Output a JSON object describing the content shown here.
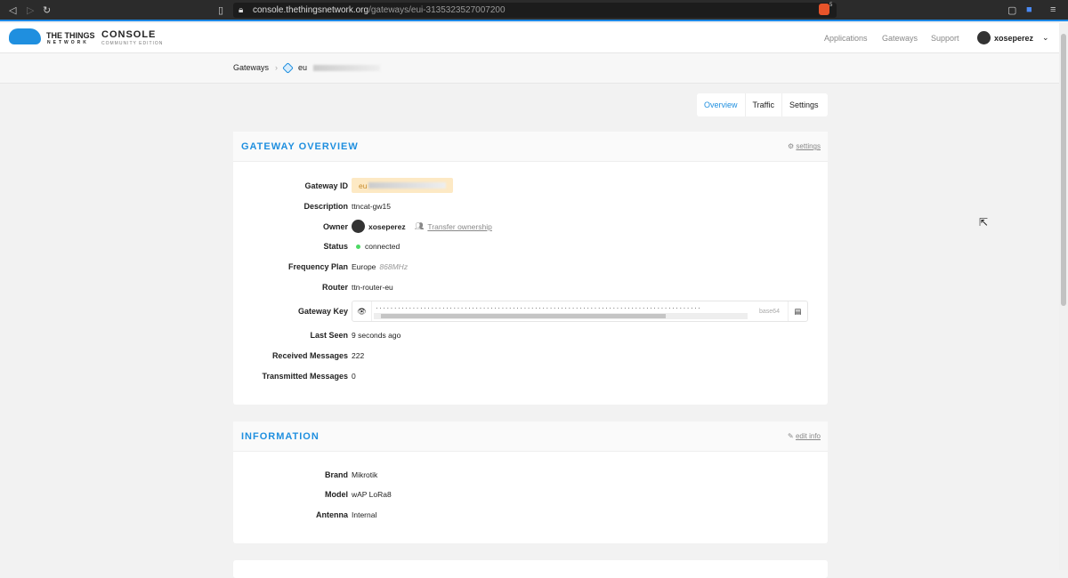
{
  "browser": {
    "url_host": "console.thethingsnetwork.org",
    "url_path": "/gateways/eui-3135323527007200",
    "brave_count": "5"
  },
  "header": {
    "logo_line1": "THE THINGS",
    "logo_line2": "NETWORK",
    "console": "CONSOLE",
    "edition": "COMMUNITY EDITION",
    "nav": [
      "Applications",
      "Gateways",
      "Support"
    ],
    "user": "xoseperez"
  },
  "breadcrumb": {
    "root": "Gateways",
    "current": "eu"
  },
  "tabs": [
    "Overview",
    "Traffic",
    "Settings"
  ],
  "overview": {
    "title": "GATEWAY OVERVIEW",
    "action": "settings",
    "gateway_id_label": "Gateway ID",
    "gateway_id": "eu",
    "description_label": "Description",
    "description": "ttncat-gw15",
    "owner_label": "Owner",
    "owner": "xoseperez",
    "transfer": "Transfer ownership",
    "status_label": "Status",
    "status": "connected",
    "freq_label": "Frequency Plan",
    "freq": "Europe",
    "freq_detail": "868MHz",
    "router_label": "Router",
    "router": "ttn-router-eu",
    "key_label": "Gateway Key",
    "key_format": "base64",
    "last_seen_label": "Last Seen",
    "last_seen": "9 seconds ago",
    "rx_label": "Received Messages",
    "rx": "222",
    "tx_label": "Transmitted Messages",
    "tx": "0"
  },
  "information": {
    "title": "INFORMATION",
    "action": "edit info",
    "brand_label": "Brand",
    "brand": "Mikrotik",
    "model_label": "Model",
    "model": "wAP LoRa8",
    "antenna_label": "Antenna",
    "antenna": "Internal"
  }
}
